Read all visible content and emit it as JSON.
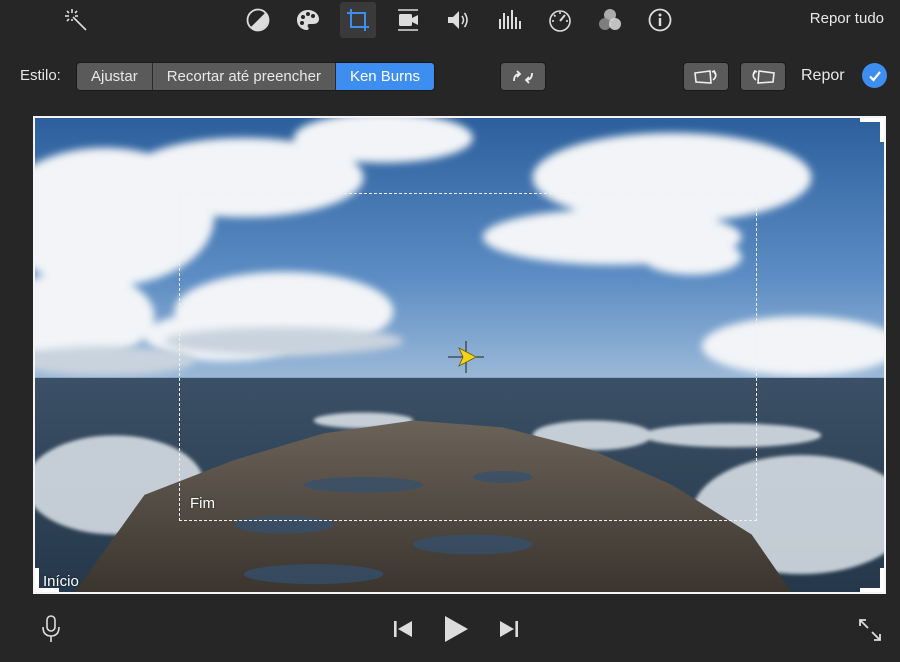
{
  "toolbar": {
    "icons": [
      "magic-wand-icon",
      "color-balance-icon",
      "color-palette-icon",
      "crop-icon",
      "stabilization-icon",
      "volume-icon",
      "equalizer-icon",
      "speed-icon",
      "filter-icon",
      "info-icon"
    ],
    "active_icon": "crop-icon",
    "reset_all_label": "Repor tudo"
  },
  "style_row": {
    "label": "Estilo:",
    "options": [
      "Ajustar",
      "Recortar até preencher",
      "Ken Burns"
    ],
    "selected": "Ken Burns",
    "reset_label": "Repor"
  },
  "viewer": {
    "start_label": "Início",
    "end_label": "Fim"
  },
  "colors": {
    "accent": "#3d8ef0",
    "background": "#262626",
    "handle_yellow": "#f5d21c"
  }
}
